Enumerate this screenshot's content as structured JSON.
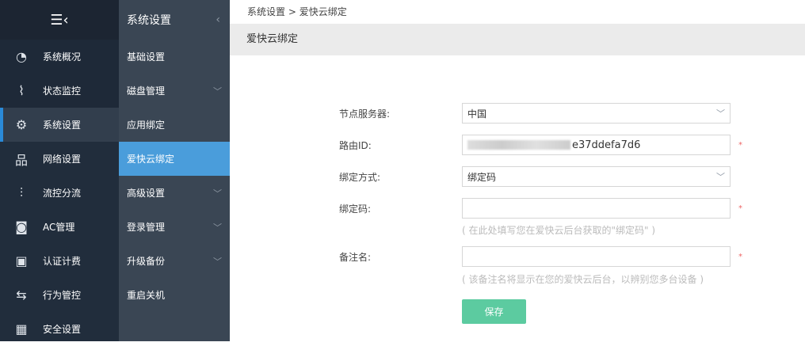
{
  "nav1": {
    "items": [
      {
        "label": "系统概况",
        "icon": "gauge-icon"
      },
      {
        "label": "状态监控",
        "icon": "pulse-icon"
      },
      {
        "label": "系统设置",
        "icon": "gear-icon"
      },
      {
        "label": "网络设置",
        "icon": "network-icon"
      },
      {
        "label": "流控分流",
        "icon": "sliders-icon"
      },
      {
        "label": "AC管理",
        "icon": "wifi-icon"
      },
      {
        "label": "认证计费",
        "icon": "id-card-icon"
      },
      {
        "label": "行为管控",
        "icon": "swap-icon"
      },
      {
        "label": "安全设置",
        "icon": "firewall-icon"
      }
    ]
  },
  "nav2": {
    "title": "系统设置",
    "items": [
      {
        "label": "基础设置"
      },
      {
        "label": "磁盘管理"
      },
      {
        "label": "应用绑定"
      },
      {
        "label": "爱快云绑定"
      },
      {
        "label": "高级设置"
      },
      {
        "label": "登录管理"
      },
      {
        "label": "升级备份"
      },
      {
        "label": "重启关机"
      }
    ]
  },
  "breadcrumb": {
    "parent": "系统设置",
    "sep": ">",
    "current": "爱快云绑定"
  },
  "page_title": "爱快云绑定",
  "form": {
    "server_label": "节点服务器:",
    "server_value": "中国",
    "routeid_label": "路由ID:",
    "routeid_value": "e37ddefa7d6",
    "method_label": "绑定方式:",
    "method_value": "绑定码",
    "code_label": "绑定码:",
    "code_value": "",
    "code_hint": "( 在此处填写您在爱快云后台获取的\"绑定码\" )",
    "remark_label": "备注名:",
    "remark_value": "",
    "remark_hint": "( 该备注名将显示在您的爱快云后台，以辨别您多台设备 )",
    "required": "*",
    "save": "保存"
  },
  "colors": {
    "accent": "#4a9ddb",
    "save": "#5ccba0"
  }
}
